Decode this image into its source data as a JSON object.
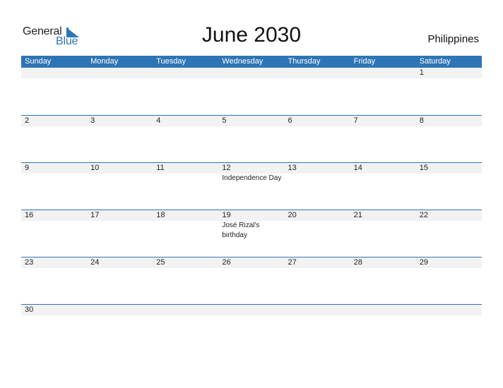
{
  "logo": {
    "line1": "General",
    "line2": "Blue",
    "accent": "#2e75b6"
  },
  "header": {
    "title": "June 2030",
    "country": "Philippines"
  },
  "colors": {
    "header_bg": "#2e75b6",
    "band_bg": "#f2f2f2"
  },
  "weekdays": [
    "Sunday",
    "Monday",
    "Tuesday",
    "Wednesday",
    "Thursday",
    "Friday",
    "Saturday"
  ],
  "weeks": [
    {
      "days": [
        {
          "num": "",
          "event": ""
        },
        {
          "num": "",
          "event": ""
        },
        {
          "num": "",
          "event": ""
        },
        {
          "num": "",
          "event": ""
        },
        {
          "num": "",
          "event": ""
        },
        {
          "num": "",
          "event": ""
        },
        {
          "num": "1",
          "event": ""
        }
      ]
    },
    {
      "days": [
        {
          "num": "2",
          "event": ""
        },
        {
          "num": "3",
          "event": ""
        },
        {
          "num": "4",
          "event": ""
        },
        {
          "num": "5",
          "event": ""
        },
        {
          "num": "6",
          "event": ""
        },
        {
          "num": "7",
          "event": ""
        },
        {
          "num": "8",
          "event": ""
        }
      ]
    },
    {
      "days": [
        {
          "num": "9",
          "event": ""
        },
        {
          "num": "10",
          "event": ""
        },
        {
          "num": "11",
          "event": ""
        },
        {
          "num": "12",
          "event": "Independence Day"
        },
        {
          "num": "13",
          "event": ""
        },
        {
          "num": "14",
          "event": ""
        },
        {
          "num": "15",
          "event": ""
        }
      ]
    },
    {
      "days": [
        {
          "num": "16",
          "event": ""
        },
        {
          "num": "17",
          "event": ""
        },
        {
          "num": "18",
          "event": ""
        },
        {
          "num": "19",
          "event": "José Rizal's birthday"
        },
        {
          "num": "20",
          "event": ""
        },
        {
          "num": "21",
          "event": ""
        },
        {
          "num": "22",
          "event": ""
        }
      ]
    },
    {
      "days": [
        {
          "num": "23",
          "event": ""
        },
        {
          "num": "24",
          "event": ""
        },
        {
          "num": "25",
          "event": ""
        },
        {
          "num": "26",
          "event": ""
        },
        {
          "num": "27",
          "event": ""
        },
        {
          "num": "28",
          "event": ""
        },
        {
          "num": "29",
          "event": ""
        }
      ]
    },
    {
      "days": [
        {
          "num": "30",
          "event": ""
        },
        {
          "num": "",
          "event": ""
        },
        {
          "num": "",
          "event": ""
        },
        {
          "num": "",
          "event": ""
        },
        {
          "num": "",
          "event": ""
        },
        {
          "num": "",
          "event": ""
        },
        {
          "num": "",
          "event": ""
        }
      ]
    }
  ]
}
